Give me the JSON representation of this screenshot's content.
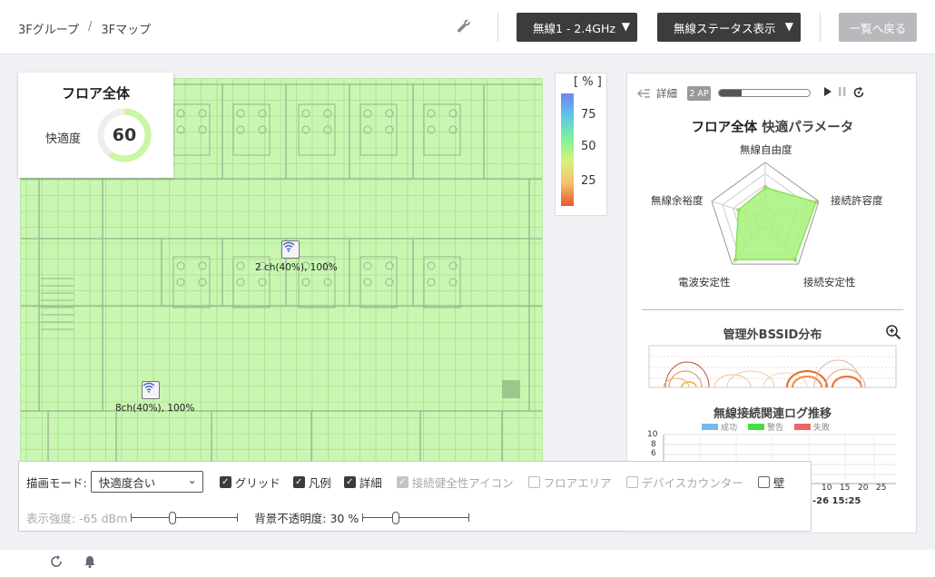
{
  "header": {
    "breadcrumb": [
      "3Fグループ",
      "3Fマップ"
    ],
    "breadcrumb_sep": "/",
    "radio_select": "無線1 - 2.4GHz",
    "view_select": "無線ステータス表示",
    "back_label": "一覧へ戻る",
    "dropdown_arrow": "▼"
  },
  "floor_card": {
    "title": "フロア全体",
    "label": "快適度",
    "value": "60",
    "value_fraction": 0.6,
    "gauge_color": "#c9f7a3"
  },
  "legend": {
    "unit": "[ % ]",
    "ticks": [
      "75",
      "50",
      "25"
    ]
  },
  "map": {
    "fill_color": "#c9f7b2",
    "access_points": [
      {
        "label": "2 ch(40%), 100%"
      },
      {
        "label": "8ch(40%), 100%"
      }
    ]
  },
  "right_panel": {
    "detail_label": "詳細",
    "ap_badge": "2 AP",
    "progress_fraction": 0.25,
    "title_main": "フロア全体",
    "title_sub": "快適パラメータ",
    "radar": {
      "labels": [
        "無線自由度",
        "接続許容度",
        "接続安定性",
        "電波安定性",
        "無線余裕度"
      ],
      "values": [
        0.55,
        0.95,
        0.9,
        0.9,
        0.5
      ],
      "fill_color": "#a6f27a"
    },
    "bssid_title": "管理外BSSID分布",
    "log_title": "無線接続関連ログ推移",
    "log_legend": [
      {
        "name": "成功",
        "color": "#77b8ec"
      },
      {
        "name": "警告",
        "color": "#44dd44"
      },
      {
        "name": "失敗",
        "color": "#ee6666"
      }
    ],
    "log_y_ticks": [
      "10",
      "8",
      "6"
    ],
    "log_x_ticks": [
      "10",
      "15",
      "20",
      "25"
    ],
    "log_date": "-26 15:25"
  },
  "toolbar": {
    "mode_label": "描画モード:",
    "mode_value": "快適度合い",
    "checkboxes": [
      {
        "label": "グリッド",
        "checked": true,
        "disabled": false
      },
      {
        "label": "凡例",
        "checked": true,
        "disabled": false
      },
      {
        "label": "詳細",
        "checked": true,
        "disabled": false
      },
      {
        "label": "接続健全性アイコン",
        "checked": true,
        "disabled": true
      },
      {
        "label": "フロアエリア",
        "checked": false,
        "disabled": true
      },
      {
        "label": "デバイスカウンター",
        "checked": false,
        "disabled": true
      },
      {
        "label": "壁",
        "checked": false,
        "disabled": false
      }
    ],
    "signal_label": "表示強度: -65 dBm",
    "opacity_label": "背景不透明度: 30 %",
    "signal_fraction": 0.38,
    "opacity_fraction": 0.3
  }
}
